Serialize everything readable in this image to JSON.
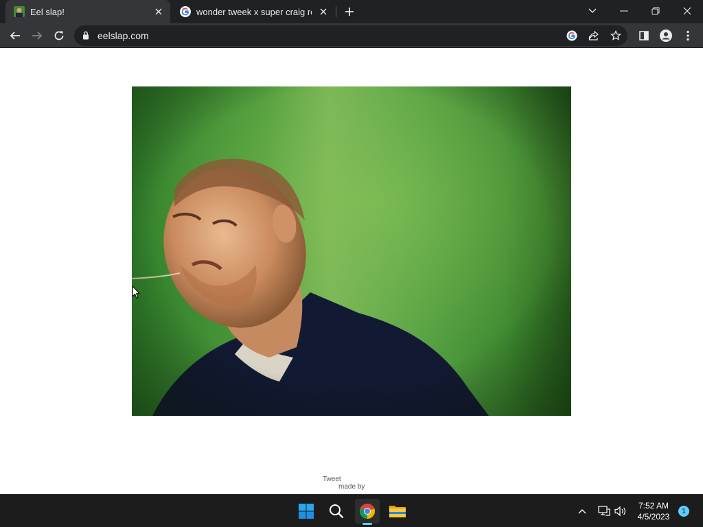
{
  "browser": {
    "tabs": [
      {
        "title": "Eel slap!",
        "active": true
      },
      {
        "title": "wonder tweek x super craig red r",
        "active": false
      }
    ],
    "url": "eelslap.com"
  },
  "page": {
    "image_description": "man on green background",
    "tweet_label": "Tweet",
    "made_by_label": "made by"
  },
  "taskbar": {
    "apps": [
      "windows-start",
      "search",
      "chrome",
      "file-explorer"
    ],
    "time": "7:52 AM",
    "date": "4/5/2023",
    "notification_count": "1"
  },
  "colors": {
    "tab_strip": "#202124",
    "toolbar": "#35363a",
    "taskbar": "#1c1c1c",
    "accent": "#60cdff"
  }
}
